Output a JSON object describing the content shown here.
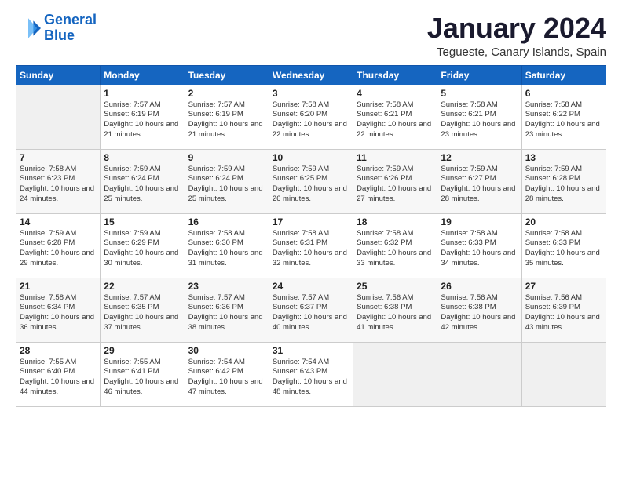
{
  "logo": {
    "line1": "General",
    "line2": "Blue"
  },
  "title": "January 2024",
  "location": "Tegueste, Canary Islands, Spain",
  "weekdays": [
    "Sunday",
    "Monday",
    "Tuesday",
    "Wednesday",
    "Thursday",
    "Friday",
    "Saturday"
  ],
  "weeks": [
    [
      {
        "day": "",
        "sunrise": "",
        "sunset": "",
        "daylight": ""
      },
      {
        "day": "1",
        "sunrise": "Sunrise: 7:57 AM",
        "sunset": "Sunset: 6:19 PM",
        "daylight": "Daylight: 10 hours and 21 minutes."
      },
      {
        "day": "2",
        "sunrise": "Sunrise: 7:57 AM",
        "sunset": "Sunset: 6:19 PM",
        "daylight": "Daylight: 10 hours and 21 minutes."
      },
      {
        "day": "3",
        "sunrise": "Sunrise: 7:58 AM",
        "sunset": "Sunset: 6:20 PM",
        "daylight": "Daylight: 10 hours and 22 minutes."
      },
      {
        "day": "4",
        "sunrise": "Sunrise: 7:58 AM",
        "sunset": "Sunset: 6:21 PM",
        "daylight": "Daylight: 10 hours and 22 minutes."
      },
      {
        "day": "5",
        "sunrise": "Sunrise: 7:58 AM",
        "sunset": "Sunset: 6:21 PM",
        "daylight": "Daylight: 10 hours and 23 minutes."
      },
      {
        "day": "6",
        "sunrise": "Sunrise: 7:58 AM",
        "sunset": "Sunset: 6:22 PM",
        "daylight": "Daylight: 10 hours and 23 minutes."
      }
    ],
    [
      {
        "day": "7",
        "sunrise": "Sunrise: 7:58 AM",
        "sunset": "Sunset: 6:23 PM",
        "daylight": "Daylight: 10 hours and 24 minutes."
      },
      {
        "day": "8",
        "sunrise": "Sunrise: 7:59 AM",
        "sunset": "Sunset: 6:24 PM",
        "daylight": "Daylight: 10 hours and 25 minutes."
      },
      {
        "day": "9",
        "sunrise": "Sunrise: 7:59 AM",
        "sunset": "Sunset: 6:24 PM",
        "daylight": "Daylight: 10 hours and 25 minutes."
      },
      {
        "day": "10",
        "sunrise": "Sunrise: 7:59 AM",
        "sunset": "Sunset: 6:25 PM",
        "daylight": "Daylight: 10 hours and 26 minutes."
      },
      {
        "day": "11",
        "sunrise": "Sunrise: 7:59 AM",
        "sunset": "Sunset: 6:26 PM",
        "daylight": "Daylight: 10 hours and 27 minutes."
      },
      {
        "day": "12",
        "sunrise": "Sunrise: 7:59 AM",
        "sunset": "Sunset: 6:27 PM",
        "daylight": "Daylight: 10 hours and 28 minutes."
      },
      {
        "day": "13",
        "sunrise": "Sunrise: 7:59 AM",
        "sunset": "Sunset: 6:28 PM",
        "daylight": "Daylight: 10 hours and 28 minutes."
      }
    ],
    [
      {
        "day": "14",
        "sunrise": "Sunrise: 7:59 AM",
        "sunset": "Sunset: 6:28 PM",
        "daylight": "Daylight: 10 hours and 29 minutes."
      },
      {
        "day": "15",
        "sunrise": "Sunrise: 7:59 AM",
        "sunset": "Sunset: 6:29 PM",
        "daylight": "Daylight: 10 hours and 30 minutes."
      },
      {
        "day": "16",
        "sunrise": "Sunrise: 7:58 AM",
        "sunset": "Sunset: 6:30 PM",
        "daylight": "Daylight: 10 hours and 31 minutes."
      },
      {
        "day": "17",
        "sunrise": "Sunrise: 7:58 AM",
        "sunset": "Sunset: 6:31 PM",
        "daylight": "Daylight: 10 hours and 32 minutes."
      },
      {
        "day": "18",
        "sunrise": "Sunrise: 7:58 AM",
        "sunset": "Sunset: 6:32 PM",
        "daylight": "Daylight: 10 hours and 33 minutes."
      },
      {
        "day": "19",
        "sunrise": "Sunrise: 7:58 AM",
        "sunset": "Sunset: 6:33 PM",
        "daylight": "Daylight: 10 hours and 34 minutes."
      },
      {
        "day": "20",
        "sunrise": "Sunrise: 7:58 AM",
        "sunset": "Sunset: 6:33 PM",
        "daylight": "Daylight: 10 hours and 35 minutes."
      }
    ],
    [
      {
        "day": "21",
        "sunrise": "Sunrise: 7:58 AM",
        "sunset": "Sunset: 6:34 PM",
        "daylight": "Daylight: 10 hours and 36 minutes."
      },
      {
        "day": "22",
        "sunrise": "Sunrise: 7:57 AM",
        "sunset": "Sunset: 6:35 PM",
        "daylight": "Daylight: 10 hours and 37 minutes."
      },
      {
        "day": "23",
        "sunrise": "Sunrise: 7:57 AM",
        "sunset": "Sunset: 6:36 PM",
        "daylight": "Daylight: 10 hours and 38 minutes."
      },
      {
        "day": "24",
        "sunrise": "Sunrise: 7:57 AM",
        "sunset": "Sunset: 6:37 PM",
        "daylight": "Daylight: 10 hours and 40 minutes."
      },
      {
        "day": "25",
        "sunrise": "Sunrise: 7:56 AM",
        "sunset": "Sunset: 6:38 PM",
        "daylight": "Daylight: 10 hours and 41 minutes."
      },
      {
        "day": "26",
        "sunrise": "Sunrise: 7:56 AM",
        "sunset": "Sunset: 6:38 PM",
        "daylight": "Daylight: 10 hours and 42 minutes."
      },
      {
        "day": "27",
        "sunrise": "Sunrise: 7:56 AM",
        "sunset": "Sunset: 6:39 PM",
        "daylight": "Daylight: 10 hours and 43 minutes."
      }
    ],
    [
      {
        "day": "28",
        "sunrise": "Sunrise: 7:55 AM",
        "sunset": "Sunset: 6:40 PM",
        "daylight": "Daylight: 10 hours and 44 minutes."
      },
      {
        "day": "29",
        "sunrise": "Sunrise: 7:55 AM",
        "sunset": "Sunset: 6:41 PM",
        "daylight": "Daylight: 10 hours and 46 minutes."
      },
      {
        "day": "30",
        "sunrise": "Sunrise: 7:54 AM",
        "sunset": "Sunset: 6:42 PM",
        "daylight": "Daylight: 10 hours and 47 minutes."
      },
      {
        "day": "31",
        "sunrise": "Sunrise: 7:54 AM",
        "sunset": "Sunset: 6:43 PM",
        "daylight": "Daylight: 10 hours and 48 minutes."
      },
      {
        "day": "",
        "sunrise": "",
        "sunset": "",
        "daylight": ""
      },
      {
        "day": "",
        "sunrise": "",
        "sunset": "",
        "daylight": ""
      },
      {
        "day": "",
        "sunrise": "",
        "sunset": "",
        "daylight": ""
      }
    ]
  ]
}
